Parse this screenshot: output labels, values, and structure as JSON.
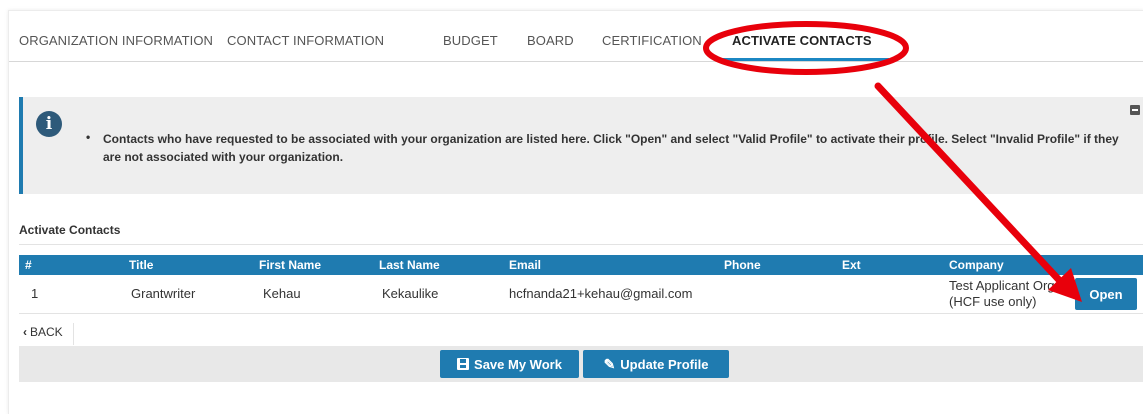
{
  "tabs": [
    {
      "label": "ORGANIZATION INFORMATION"
    },
    {
      "label": "CONTACT INFORMATION"
    },
    {
      "label": "BUDGET"
    },
    {
      "label": "BOARD"
    },
    {
      "label": "CERTIFICATION"
    },
    {
      "label": "ACTIVATE CONTACTS"
    }
  ],
  "active_tab": "ACTIVATE CONTACTS",
  "info": {
    "bullet": "•",
    "text": "Contacts who have requested to be associated with your organization are listed here. Click \"Open\" and select \"Valid Profile\" to activate their profile. Select \"Invalid Profile\" if they are not associated with your organization."
  },
  "section": {
    "title": "Activate Contacts"
  },
  "table": {
    "headers": [
      "#",
      "Title",
      "First Name",
      "Last Name",
      "Email",
      "Phone",
      "Ext",
      "Company"
    ],
    "rows": [
      {
        "num": "1",
        "title": "Grantwriter",
        "first": "Kehau",
        "last": "Kekaulike",
        "email": "hcfnanda21+kehau@gmail.com",
        "phone": "",
        "ext": "",
        "company": "Test Applicant Org (HCF use only)",
        "action": "Open"
      }
    ]
  },
  "back_label": "BACK",
  "buttons": {
    "save": "Save My Work",
    "update": "Update Profile"
  },
  "colors": {
    "accent": "#1f7bb0",
    "annotation": "#e8000b"
  },
  "icons": [
    "info-icon",
    "collapse-icon",
    "chevron-left-icon",
    "save-icon",
    "pencil-icon"
  ]
}
